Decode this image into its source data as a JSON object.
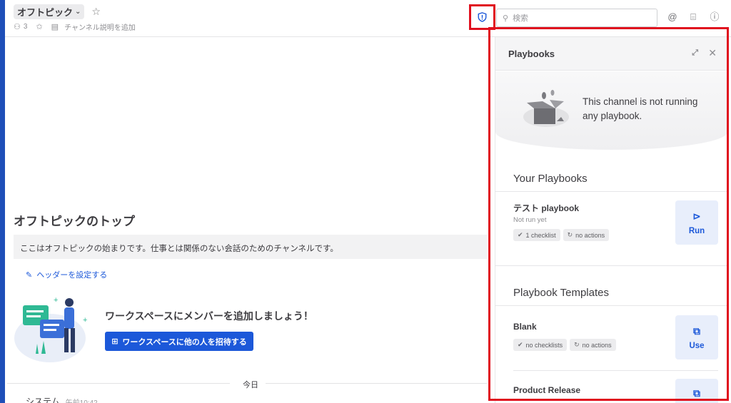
{
  "header": {
    "channel_name": "オフトピック",
    "member_count": "3",
    "add_description": "チャンネル説明を追加",
    "search_placeholder": "検索"
  },
  "main": {
    "intro_title": "オフトピックのトップ",
    "intro_description": "ここはオフトピックの始まりです。仕事とは関係のない会話のためのチャンネルです。",
    "set_header": "ヘッダーを設定する",
    "add_members_prompt": "ワークスペースにメンバーを追加しましょう！",
    "invite_button": "ワークスペースに他の人を招待する",
    "date_separator": "今日",
    "system_author": "システム",
    "system_time": "午前10:42"
  },
  "rhs": {
    "title": "Playbooks",
    "not_running_message": "This channel is not running any playbook.",
    "your_playbooks_title": "Your Playbooks",
    "playbooks": [
      {
        "name": "テスト playbook",
        "status": "Not run yet",
        "checklists": "1 checklist",
        "actions": "no actions",
        "button": "Run"
      }
    ],
    "templates_title": "Playbook Templates",
    "templates": [
      {
        "name": "Blank",
        "checklists": "no checklists",
        "actions": "no actions",
        "button": "Use"
      },
      {
        "name": "Product Release"
      }
    ]
  },
  "colors": {
    "accent": "#1c58d9",
    "highlight_border": "#e0101e",
    "sidebar": "#1e4fb8"
  }
}
